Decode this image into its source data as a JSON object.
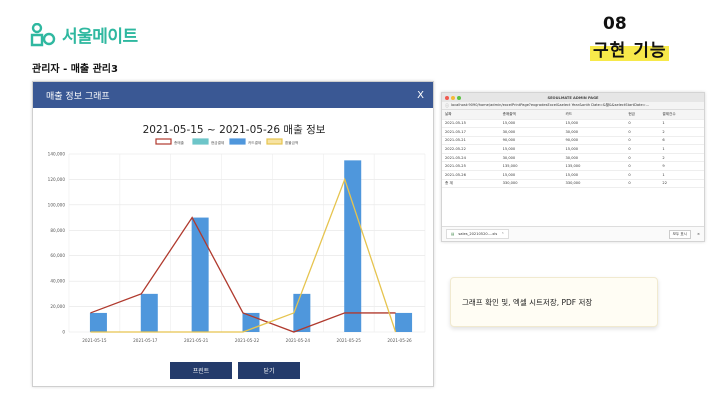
{
  "logo": {
    "text": "서울메이트",
    "brand_color": "#2fb8a0"
  },
  "section": {
    "number": "08",
    "title": "구현 기능",
    "highlight_color": "#f7e94a"
  },
  "page_heading": "관리자 - 매출 관리3",
  "modal": {
    "title": "매출 정보 그래프",
    "close_label": "X",
    "header_color": "#3a5894",
    "buttons": {
      "print": "프린트",
      "close": "닫기"
    }
  },
  "chart_data": {
    "type": "bar",
    "title": "2021-05-15 ~ 2021-05-26 매출 정보",
    "categories": [
      "2021-05-15",
      "2021-05-17",
      "2021-05-21",
      "2021-05-22",
      "2021-05-24",
      "2021-05-25",
      "2021-05-26"
    ],
    "series": [
      {
        "name": "총매출",
        "kind": "line",
        "color": "#b03a2e",
        "values": [
          15000,
          30000,
          90000,
          15000,
          0,
          15000,
          15000
        ]
      },
      {
        "name": "현금결제",
        "kind": "bar",
        "color": "#6dc5c9",
        "values": [
          0,
          0,
          0,
          0,
          0,
          0,
          0
        ]
      },
      {
        "name": "카드결제",
        "kind": "bar",
        "color": "#4f97dc",
        "values": [
          15000,
          30000,
          90000,
          15000,
          30000,
          135000,
          15000
        ]
      },
      {
        "name": "환불금액",
        "kind": "line",
        "color": "#e6c44f",
        "values": [
          0,
          0,
          0,
          0,
          15000,
          120000,
          0
        ]
      }
    ],
    "yticks": [
      0,
      20000,
      40000,
      60000,
      80000,
      100000,
      120000,
      140000
    ],
    "ylim": [
      0,
      140000
    ],
    "grid": true,
    "legend": "top-center"
  },
  "browser": {
    "window_title": "SEOULMATE ADMIN PAGE",
    "url": "localhost:9090/home/admin/excelPrintPage?exgradesExcel&select Year&onth Date=&할&&selectStartDate=...",
    "table": {
      "headers": [
        "날짜",
        "총매출액",
        "카드",
        "현금",
        "결제건수"
      ],
      "rows": [
        [
          "2021-05-15",
          "15,000",
          "15,000",
          "0",
          "1"
        ],
        [
          "2021-05-17",
          "30,000",
          "30,000",
          "0",
          "2"
        ],
        [
          "2021-05-21",
          "90,000",
          "90,000",
          "0",
          "6"
        ],
        [
          "2022-05-22",
          "15,000",
          "15,000",
          "0",
          "1"
        ],
        [
          "2021-05-24",
          "30,000",
          "30,000",
          "0",
          "2"
        ],
        [
          "2021-05-25",
          "135,000",
          "135,000",
          "0",
          "9"
        ],
        [
          "2021-05-26",
          "15,000",
          "15,000",
          "0",
          "1"
        ],
        [
          "총 계",
          "330,000",
          "330,000",
          "0",
          "22"
        ]
      ]
    },
    "download": {
      "file_name": "sales_20210520....xls",
      "show_all": "모두 표시",
      "close": "×"
    }
  },
  "note": "그래프 확인 및, 엑셀 시트저장, PDF 저장"
}
